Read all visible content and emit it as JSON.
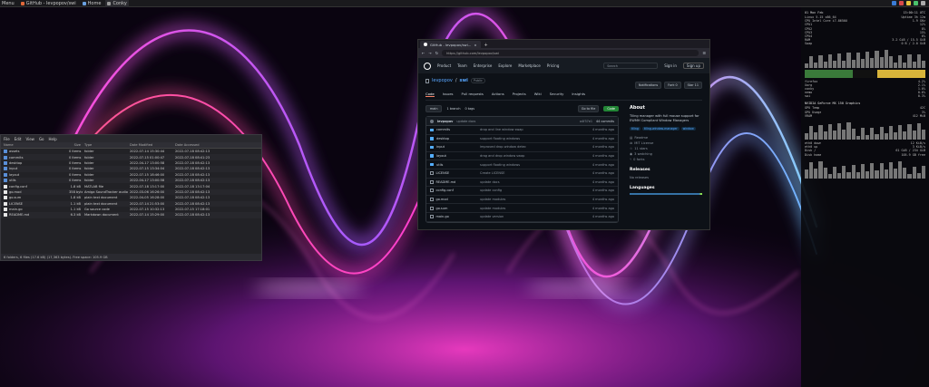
{
  "taskbar": {
    "menu_label": "Menu",
    "items": [
      {
        "label": "GitHub - levpopov/swi",
        "color": "#e0683a"
      },
      {
        "label": "Home",
        "color": "#6aa0e0"
      },
      {
        "label": "Conky",
        "color": "#999999"
      }
    ],
    "tray_colors": [
      "#3a7bd5",
      "#d84a4a",
      "#e8c33c",
      "#4ac26b",
      "#aaaaaa"
    ]
  },
  "file_manager": {
    "menu": [
      "File",
      "Edit",
      "View",
      "Go",
      "Help"
    ],
    "columns": [
      "Name",
      "Size",
      "Type",
      "Date Modified",
      "Date Accessed"
    ],
    "rows": [
      {
        "name": "assets",
        "size": "0 items",
        "type": "folder",
        "modified": "2022-07-14 15:30:44",
        "accessed": "2022-07-18 08:42:13",
        "kind": "folder"
      },
      {
        "name": "commits",
        "size": "0 items",
        "type": "folder",
        "modified": "2022-07-15 01:00:47",
        "accessed": "2022-07-18 08:41:23",
        "kind": "folder"
      },
      {
        "name": "desktop",
        "size": "0 items",
        "type": "folder",
        "modified": "2022-04-17 13:00:58",
        "accessed": "2022-07-18 08:42:13",
        "kind": "folder"
      },
      {
        "name": "input",
        "size": "0 items",
        "type": "folder",
        "modified": "2022-07-15 13:34:04",
        "accessed": "2022-07-18 08:42:13",
        "kind": "folder"
      },
      {
        "name": "layout",
        "size": "0 items",
        "type": "folder",
        "modified": "2022-07-15 18:46:00",
        "accessed": "2022-07-18 08:42:13",
        "kind": "folder"
      },
      {
        "name": "utils",
        "size": "0 items",
        "type": "folder",
        "modified": "2022-04-17 13:00:58",
        "accessed": "2022-07-18 08:42:13",
        "kind": "folder"
      },
      {
        "name": "config.conf",
        "size": "1.8 kB",
        "type": "MATLAB file",
        "modified": "2022-07-18 13:17:00",
        "accessed": "2022-07-18 13:17:04",
        "kind": "file"
      },
      {
        "name": "go.mod",
        "size": "358 bytes",
        "type": "Amiga SoundTracker audio",
        "modified": "2022-03-06 16:26:00",
        "accessed": "2022-07-18 08:42:13",
        "kind": "file"
      },
      {
        "name": "go.sum",
        "size": "1.8 kB",
        "type": "plain text document",
        "modified": "2022-04-05 16:28:00",
        "accessed": "2022-07-18 08:42:13",
        "kind": "file"
      },
      {
        "name": "LICENSE",
        "size": "1.1 kB",
        "type": "plain text document",
        "modified": "2022-07-14 21:53:00",
        "accessed": "2022-07-18 08:42:13",
        "kind": "file"
      },
      {
        "name": "main.go",
        "size": "1.1 kB",
        "type": "Go source code",
        "modified": "2022-07-15 10:32:13",
        "accessed": "2022-07-15 17:18:01",
        "kind": "file"
      },
      {
        "name": "README.md",
        "size": "6.3 kB",
        "type": "Markdown document",
        "modified": "2022-07-14 15:29:00",
        "accessed": "2022-07-18 08:42:13",
        "kind": "file"
      }
    ],
    "status": "6 folders, 6 files (17.6 kB) (17,363 bytes). Free space: 105.9 GB"
  },
  "browser": {
    "tab_title": "GitHub - levpopov/swi...",
    "url": "https://github.com/levpopov/swi",
    "gh_nav": [
      "Product",
      "Team",
      "Enterprise",
      "Explore",
      "Marketplace",
      "Pricing"
    ],
    "search_placeholder": "Search",
    "sign_in": "Sign in",
    "sign_up": "Sign up",
    "repo_owner": "levpopov",
    "repo_name": "swi",
    "repo_visibility": "Public",
    "repo_actions": [
      "Notifications",
      "Fork 0",
      "Star 11"
    ],
    "repo_tabs": [
      "Code",
      "Issues",
      "Pull requests",
      "Actions",
      "Projects",
      "Wiki",
      "Security",
      "Insights"
    ],
    "branch": "main",
    "branches": "1 branch",
    "tags": "0 tags",
    "go_to_file": "Go to file",
    "code_btn": "Code",
    "latest_commit_author": "levpopov",
    "latest_commit_msg": "update docs",
    "latest_commit_hash": "a4f37e1",
    "commit_count": "44 commits",
    "files": [
      {
        "name": "commits",
        "msg": "drop and line window swap",
        "time": "4 months ago",
        "kind": "dir"
      },
      {
        "name": "desktop",
        "msg": "support floating windows",
        "time": "4 months ago",
        "kind": "dir"
      },
      {
        "name": "input",
        "msg": "improved drop window detec",
        "time": "4 months ago",
        "kind": "dir"
      },
      {
        "name": "layout",
        "msg": "drag and drop window swap",
        "time": "4 months ago",
        "kind": "dir"
      },
      {
        "name": "utils",
        "msg": "support floating windows",
        "time": "4 months ago",
        "kind": "dir"
      },
      {
        "name": "LICENSE",
        "msg": "Create LICENSE",
        "time": "4 months ago",
        "kind": "file"
      },
      {
        "name": "README.md",
        "msg": "update docs",
        "time": "4 months ago",
        "kind": "file"
      },
      {
        "name": "config.conf",
        "msg": "update config",
        "time": "4 months ago",
        "kind": "file"
      },
      {
        "name": "go.mod",
        "msg": "update modules",
        "time": "4 months ago",
        "kind": "file"
      },
      {
        "name": "go.sum",
        "msg": "update modules",
        "time": "4 months ago",
        "kind": "file"
      },
      {
        "name": "main.go",
        "msg": "update version",
        "time": "4 months ago",
        "kind": "file"
      }
    ],
    "about_heading": "About",
    "about_desc": "Tiling manager with full mouse support for EWMH Compliant Window Managers",
    "topics": [
      "tiling",
      "tiling-window-manager",
      "window"
    ],
    "about_items": [
      "Readme",
      "MIT License",
      "11 stars",
      "3 watching",
      "0 forks"
    ],
    "releases_heading": "Releases",
    "releases_text": "No releases",
    "languages_heading": "Languages"
  },
  "conky": {
    "title": "Conky",
    "header_left": "01 Mon Feb",
    "header_right": "13:00:11 UTC",
    "lines": [
      [
        "Linux 5.15 x86_64",
        "Uptime 3h 12m"
      ],
      [
        "CPU Intel Core i7-8650U",
        "1.9 GHz"
      ],
      [
        "CPU1",
        "12%"
      ],
      [
        "CPU2",
        "8%"
      ],
      [
        "CPU3",
        "15%"
      ],
      [
        "CPU4",
        "6%"
      ],
      [
        "RAM",
        "3.2 GiB / 15.5 GiB"
      ],
      [
        "Swap",
        "0 B / 2.0 GiB"
      ]
    ],
    "proc_lines": [
      [
        "firefox",
        "4.2%"
      ],
      [
        "Xorg",
        "2.1%"
      ],
      [
        "conky",
        "1.0%"
      ],
      [
        "nemo",
        "0.6%"
      ],
      [
        "swi",
        "0.3%"
      ]
    ],
    "gpu_title": "NVIDIA GeForce MX 150 Graphics",
    "gpu_lines": [
      [
        "GPU Temp",
        "42C"
      ],
      [
        "GPU Usage",
        "3%"
      ],
      [
        "VRAM",
        "412 MiB"
      ]
    ],
    "net_lines": [
      [
        "eth0 down",
        "12 KiB/s"
      ],
      [
        "eth0 up",
        "3 KiB/s"
      ],
      [
        "Disk /",
        "61 GiB / 234 GiB"
      ],
      [
        "Disk home",
        "105.9 GB free"
      ]
    ],
    "graph_colors": [
      "#3a7a3a",
      "#d8b43a",
      "#888888"
    ]
  }
}
